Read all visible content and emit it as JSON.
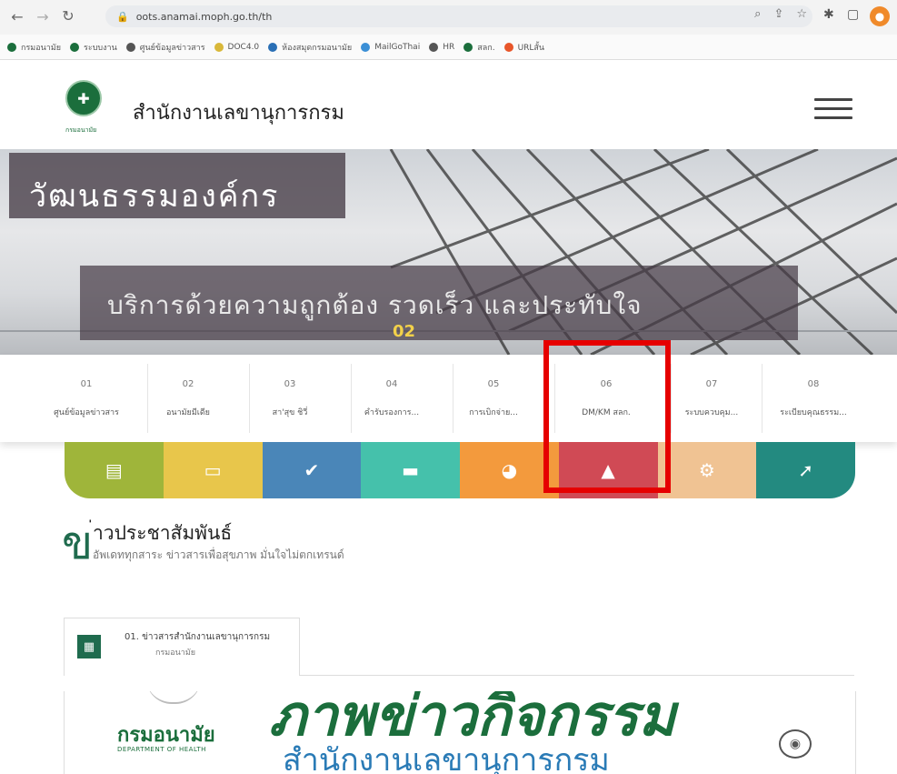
{
  "browser": {
    "url": "oots.anamai.moph.go.th/th",
    "bookmarks": [
      "กรมอนามัย",
      "ระบบงาน",
      "ศูนย์ข้อมูลข่าวสาร",
      "DOC4.0",
      "ห้องสมุดกรมอนามัย",
      "MailGoThai",
      "HR",
      "สลก.",
      "URLสั้น"
    ]
  },
  "header": {
    "site_title": "สำนักงานเลขานุการกรม",
    "logo_caption": "กรมอนามัย"
  },
  "hero": {
    "title": "วัฒนธรรมองค์กร",
    "subtitle": "บริการด้วยความถูกต้อง รวดเร็ว และประทับใจ",
    "slide_number": "02"
  },
  "tabs": [
    {
      "num": "01",
      "label": "ศูนย์ข้อมูลข่าวสาร"
    },
    {
      "num": "02",
      "label": "อนามัยมีเดีย"
    },
    {
      "num": "03",
      "label": "สา'สุข ชิวี่"
    },
    {
      "num": "04",
      "label": "คำรับรองการ..."
    },
    {
      "num": "05",
      "label": "การเบิกจ่าย..."
    },
    {
      "num": "06",
      "label": "DM/KM สลก."
    },
    {
      "num": "07",
      "label": "ระบบควบคุม..."
    },
    {
      "num": "08",
      "label": "ระเบียบคุณธรรม..."
    }
  ],
  "iconbar": [
    {
      "icon": "clipboard-icon",
      "color": "#9fb53a",
      "glyph": "▤"
    },
    {
      "icon": "document-icon",
      "color": "#e8c64b",
      "glyph": "▭"
    },
    {
      "icon": "check-icon",
      "color": "#4a86b8",
      "glyph": "✔"
    },
    {
      "icon": "archive-icon",
      "color": "#45c1ab",
      "glyph": "▬"
    },
    {
      "icon": "pie-chart-icon",
      "color": "#f39a3d",
      "glyph": "◕"
    },
    {
      "icon": "graduation-cap-icon",
      "color": "#d04a55",
      "glyph": "▲"
    },
    {
      "icon": "gear-icon",
      "color": "#f0c393",
      "glyph": "⚙"
    },
    {
      "icon": "gavel-icon",
      "color": "#238a80",
      "glyph": "➚"
    }
  ],
  "news": {
    "glyph": "ข",
    "title": "่าวประชาสัมพันธ์",
    "subtitle": "อัพเดททุกสาระ ข่าวสารเพื่อสุขภาพ มั่นใจไม่ตกเทรนด์",
    "tab_title": "01. ข่าวสารสำนักงานเลขานุการกรม",
    "tab_sub": "กรมอนามัย"
  },
  "banner": {
    "org_th": "กรมอนามัย",
    "org_en": "DEPARTMENT OF HEALTH",
    "main": "สำนักงานเลขานุการกรม",
    "big_text": "ภาพข่าวกิจกรรม"
  }
}
